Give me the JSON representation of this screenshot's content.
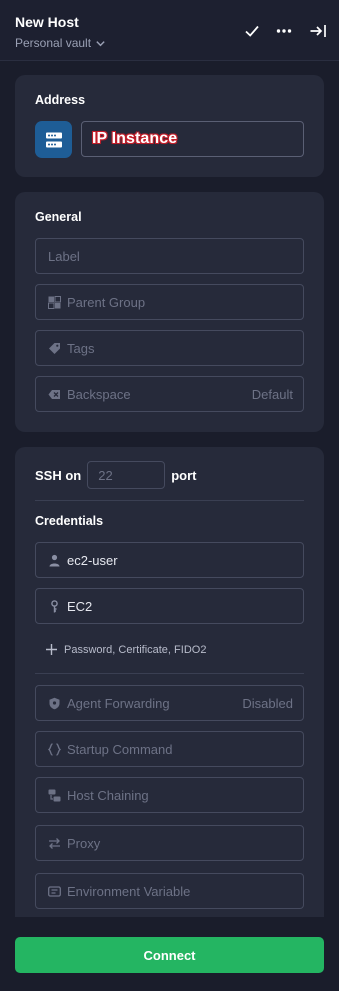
{
  "header": {
    "title": "New Host",
    "vault_label": "Personal vault",
    "icons": [
      "checkmark-icon",
      "more-icon",
      "collapse-panel-icon"
    ]
  },
  "address": {
    "section_title": "Address",
    "value": "IP Instance",
    "icon": "server-icon"
  },
  "general": {
    "section_title": "General",
    "label_placeholder": "Label",
    "parent_group_placeholder": "Parent Group",
    "tags_placeholder": "Tags",
    "backspace_label": "Backspace",
    "backspace_value": "Default"
  },
  "ssh": {
    "prefix": "SSH on",
    "port_placeholder": "22",
    "suffix": "port",
    "credentials_title": "Credentials",
    "username": "ec2-user",
    "key": "EC2",
    "add_credential_label": "Password, Certificate, FIDO2",
    "agent_forwarding_label": "Agent Forwarding",
    "agent_forwarding_value": "Disabled",
    "startup_command_label": "Startup Command",
    "host_chaining_label": "Host Chaining",
    "proxy_label": "Proxy",
    "environment_variable_label": "Environment Variable"
  },
  "footer": {
    "connect_label": "Connect"
  },
  "colors": {
    "background": "#1a1d2b",
    "card": "#262a3a",
    "accent_green": "#24b562",
    "server_icon_bg": "#1e5d96"
  }
}
